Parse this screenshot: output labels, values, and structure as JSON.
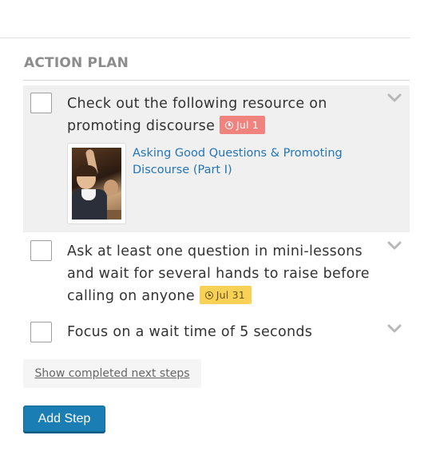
{
  "section": {
    "title": "ACTION PLAN"
  },
  "steps": [
    {
      "text": "Check out the following resource on promoting discourse",
      "due": "Jul 1",
      "due_status": "overdue",
      "resource": {
        "title": "Asking Good Questions & Promoting Discourse (Part I)"
      }
    },
    {
      "text": "Ask at least one question in mini-lessons and wait for several hands to raise before calling on anyone",
      "due": "Jul 31",
      "due_status": "upcoming"
    },
    {
      "text": "Focus on a wait time of 5 seconds"
    }
  ],
  "show_completed_label": "Show completed next steps",
  "add_step_label": "Add Step",
  "colors": {
    "overdue_badge": "#f0837d",
    "upcoming_badge": "#f7d257",
    "link": "#2575b5",
    "primary_button": "#1a7db3",
    "active_row": "#f0f0f0"
  },
  "icons": {
    "clock": "clock-icon",
    "expand": "chevron-down-icon"
  }
}
